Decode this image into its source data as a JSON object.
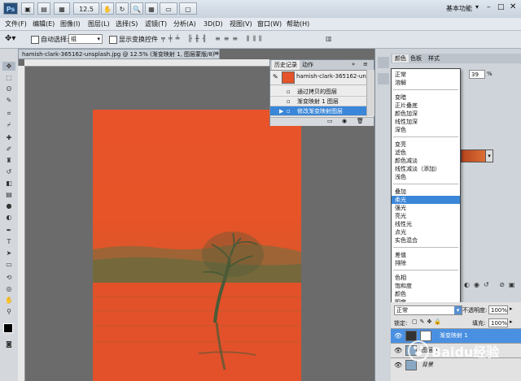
{
  "titlebar": {
    "ps_logo": "Ps",
    "zoom_value": "12.5",
    "workspace": "基本功能"
  },
  "menu": [
    "文件(F)",
    "编辑(E)",
    "图像(I)",
    "图层(L)",
    "选择(S)",
    "滤镜(T)",
    "分析(A)",
    "3D(D)",
    "视图(V)",
    "窗口(W)",
    "帮助(H)"
  ],
  "options": {
    "auto_select_label": "自动选择:",
    "auto_select_value": "组",
    "show_transform_label": "显示变换控件"
  },
  "document": {
    "tab_title": "hamish-clark-365162-unsplash.jpg @ 12.5% (渐变映射 1, 图层蒙版/8) *"
  },
  "history": {
    "tabs": [
      "历史记录",
      "动作"
    ],
    "snapshot_name": "hamish-clark-365162-uns...",
    "items": [
      "通过拷贝的图层",
      "渐变映射 1 图层",
      "修改渐变映射图层"
    ],
    "selected_index": 2
  },
  "right_panel": {
    "tabs": [
      "颜色",
      "色板",
      "样式"
    ],
    "opacity_value": "39",
    "opacity_unit": "%"
  },
  "blend_menu": {
    "groups": [
      [
        "正常",
        "溶解"
      ],
      [
        "变暗",
        "正片叠底",
        "颜色加深",
        "线性加深",
        "深色"
      ],
      [
        "变亮",
        "滤色",
        "颜色减淡",
        "线性减淡（添加）",
        "浅色"
      ],
      [
        "叠加",
        "柔光",
        "强光",
        "亮光",
        "线性光",
        "点光",
        "实色混合"
      ],
      [
        "差值",
        "排除"
      ],
      [
        "色相",
        "饱和度",
        "颜色",
        "明度"
      ]
    ],
    "selected": "柔光"
  },
  "layers": {
    "blend_mode": "正常",
    "opacity_label": "不透明度:",
    "opacity_value": "100%",
    "lock_label": "锁定:",
    "fill_label": "填充:",
    "fill_value": "100%",
    "rows": [
      {
        "name": "渐变映射 1",
        "selected": true
      },
      {
        "name": "图层 1",
        "selected": false
      },
      {
        "name": "背景",
        "selected": false
      }
    ]
  },
  "watermark": {
    "text": "Baidu经验"
  },
  "colors": {
    "canvas_orange": "#e4532a",
    "selection_blue": "#3a86d8",
    "tree": "#4a5a36"
  }
}
